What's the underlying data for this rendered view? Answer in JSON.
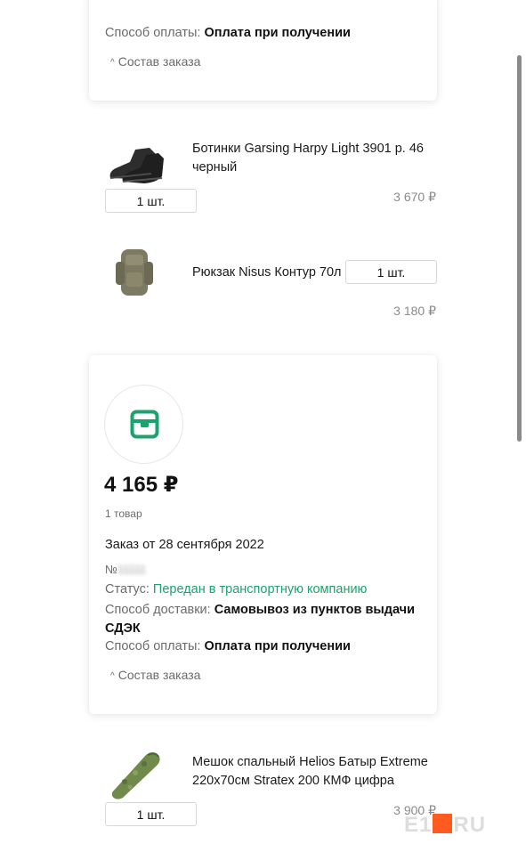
{
  "top_card": {
    "payment_label": "Способ оплаты:",
    "payment_value": "Оплата при получении",
    "order_contents_toggle": "Состав заказа"
  },
  "top_items": [
    {
      "name": "Ботинки Garsing Harpy Light 3901 р. 46 черный",
      "quantity": "1 шт.",
      "price": "3 670 ₽"
    },
    {
      "name": "Рюкзак Nisus Контур 70л",
      "quantity": "1 шт.",
      "price": "3 180 ₽"
    }
  ],
  "order": {
    "icon": "package-icon",
    "total": "4 165 ₽",
    "item_count": "1 товар",
    "date_text": "Заказ от 28 сентября 2022",
    "number_label": "№",
    "number_value": "11111",
    "status_label": "Статус:",
    "status_value": "Передан в транспортную компанию",
    "delivery_label": "Способ доставки:",
    "delivery_value": "Самовывоз из пунктов выдачи СДЭК",
    "payment_label": "Способ оплаты:",
    "payment_value": "Оплата при получении",
    "order_contents_toggle": "Состав заказа"
  },
  "order_items": [
    {
      "name": "Мешок спальный Helios Батыр Extreme 220x70см Stratex 200 КМФ цифра",
      "quantity": "1 шт.",
      "price": "3 900 ₽"
    }
  ],
  "watermark": {
    "left": "E1",
    "right": "RU"
  },
  "colors": {
    "status_green": "#1aa36e",
    "icon_green": "#1aa36e"
  }
}
